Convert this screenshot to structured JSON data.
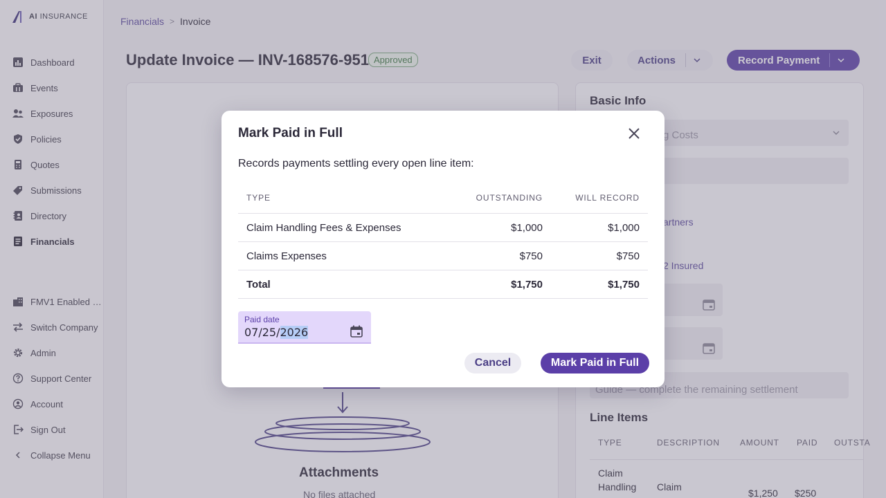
{
  "brand": {
    "prefix": "AI",
    "name": "INSURANCE"
  },
  "sidebar": {
    "items": [
      {
        "label": "Dashboard",
        "icon": "bar-chart-icon"
      },
      {
        "label": "Events",
        "icon": "briefcase-icon"
      },
      {
        "label": "Exposures",
        "icon": "people-icon"
      },
      {
        "label": "Policies",
        "icon": "shield-icon"
      },
      {
        "label": "Quotes",
        "icon": "calculator-icon"
      },
      {
        "label": "Submissions",
        "icon": "tag-icon"
      },
      {
        "label": "Directory",
        "icon": "address-book-icon"
      },
      {
        "label": "Financials",
        "icon": "ledger-icon",
        "active": true
      }
    ],
    "bottom": [
      {
        "label": "FMV1 Enabled …",
        "icon": "building-icon"
      },
      {
        "label": "Switch Company",
        "icon": "swap-icon"
      },
      {
        "label": "Admin",
        "icon": "gear-icon"
      },
      {
        "label": "Support Center",
        "icon": "help-icon"
      },
      {
        "label": "Account",
        "icon": "account-icon"
      },
      {
        "label": "Sign Out",
        "icon": "sign-out-icon"
      },
      {
        "label": "Collapse Menu",
        "icon": "chevron-left-icon"
      }
    ]
  },
  "breadcrumb": {
    "parent": "Financials",
    "separator": ">",
    "current": "Invoice"
  },
  "header": {
    "title": "Update Invoice — INV-168576-951",
    "status": "Approved",
    "exit_label": "Exit",
    "actions_label": "Actions",
    "record_label": "Record Payment"
  },
  "right_panel": {
    "basic_info_title": "Basic Info",
    "select_text": "g Costs",
    "link1": "artners",
    "link2": "2 Insured",
    "guide_text": "Guide — complete the remaining settlement",
    "line_items_title": "Line Items",
    "line_item_headers": [
      "TYPE",
      "DESCRIPTION",
      "AMOUNT",
      "PAID",
      "OUTSTA"
    ],
    "line_item_row": {
      "type1": "Claim",
      "type2": "Handling",
      "desc": "Claim",
      "amount": "$1,250",
      "paid": "$250"
    }
  },
  "left_panel": {
    "attachments_title": "Attachments",
    "attachments_sub": "No files attached"
  },
  "modal": {
    "title": "Mark Paid in Full",
    "description": "Records payments settling every open line item:",
    "headers": {
      "type": "TYPE",
      "outstanding": "OUTSTANDING",
      "will_record": "WILL RECORD"
    },
    "rows": [
      {
        "type": "Claim Handling Fees & Expenses",
        "outstanding": "$1,000",
        "will_record": "$1,000"
      },
      {
        "type": "Claims Expenses",
        "outstanding": "$750",
        "will_record": "$750"
      }
    ],
    "total": {
      "type": "Total",
      "outstanding": "$1,750",
      "will_record": "$1,750"
    },
    "date_label": "Paid date",
    "date_prefix": "07/25/",
    "date_selected": "2026",
    "cancel_label": "Cancel",
    "confirm_label": "Mark Paid in Full"
  },
  "colors": {
    "accent": "#5b3fa8",
    "status_green": "#3f7a45",
    "date_field": "#e3d7fb"
  }
}
